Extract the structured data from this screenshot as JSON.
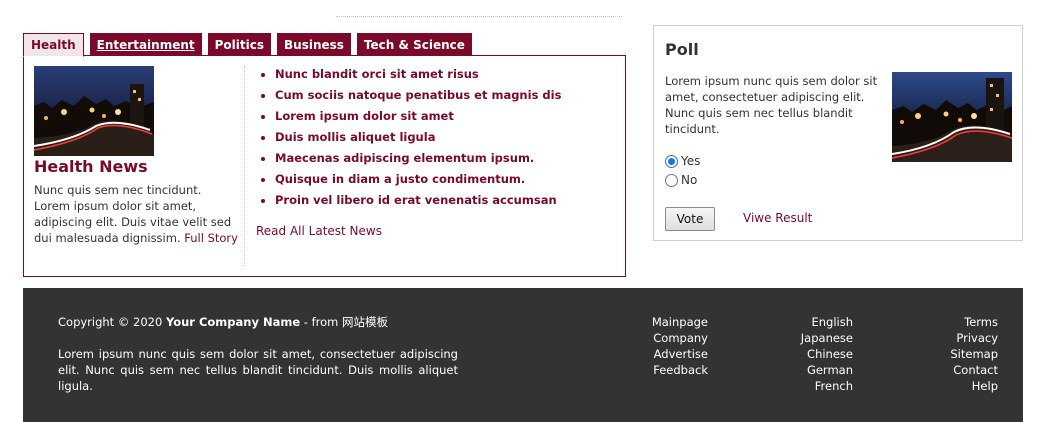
{
  "tabs": [
    {
      "label": "Health",
      "active": true
    },
    {
      "label": "Entertainment",
      "active": false
    },
    {
      "label": "Politics",
      "active": false
    },
    {
      "label": "Business",
      "active": false
    },
    {
      "label": "Tech & Science",
      "active": false
    }
  ],
  "news": {
    "title": "Health News",
    "text": "Nunc quis sem nec tincidunt. Lorem ipsum dolor sit amet, adipiscing elit. Duis vitae velit sed dui malesuada dignissim.",
    "link": "Full Story",
    "items": [
      "Nunc blandit orci sit amet risus",
      "Cum sociis natoque penatibus et magnis dis",
      "Lorem ipsum dolor sit amet",
      "Duis mollis aliquet ligula",
      "Maecenas adipiscing elementum ipsum.",
      "Quisque in diam a justo condimentum.",
      "Proin vel libero id erat venenatis accumsan"
    ],
    "read_all": "Read All Latest News"
  },
  "poll": {
    "title": "Poll",
    "text": "Lorem ipsum nunc quis sem dolor sit amet, consectetuer adipiscing elit. Nunc quis sem nec tellus blandit tincidunt.",
    "options": [
      {
        "label": "Yes",
        "checked": true
      },
      {
        "label": "No",
        "checked": false
      }
    ],
    "vote_label": "Vote",
    "view_result": "Viwe Result"
  },
  "footer": {
    "copyright_prefix": "Copyright © 2020 ",
    "company": "Your Company Name",
    "copyright_suffix": " - from 网站模板",
    "text": "Lorem ipsum nunc quis sem dolor sit amet, consectetuer adipiscing elit. Nunc quis sem nec tellus blandit tincidunt. Duis mollis aliquet ligula.",
    "nav_links": [
      "Mainpage",
      "Company",
      "Advertise",
      "Feedback"
    ],
    "lang_links": [
      "English",
      "Japanese",
      "Chinese",
      "German",
      "French"
    ],
    "legal_links": [
      "Terms",
      "Privacy",
      "Sitemap",
      "Contact",
      "Help"
    ]
  },
  "colors": {
    "accent": "#7b0a2a",
    "footer_bg": "#333333"
  }
}
